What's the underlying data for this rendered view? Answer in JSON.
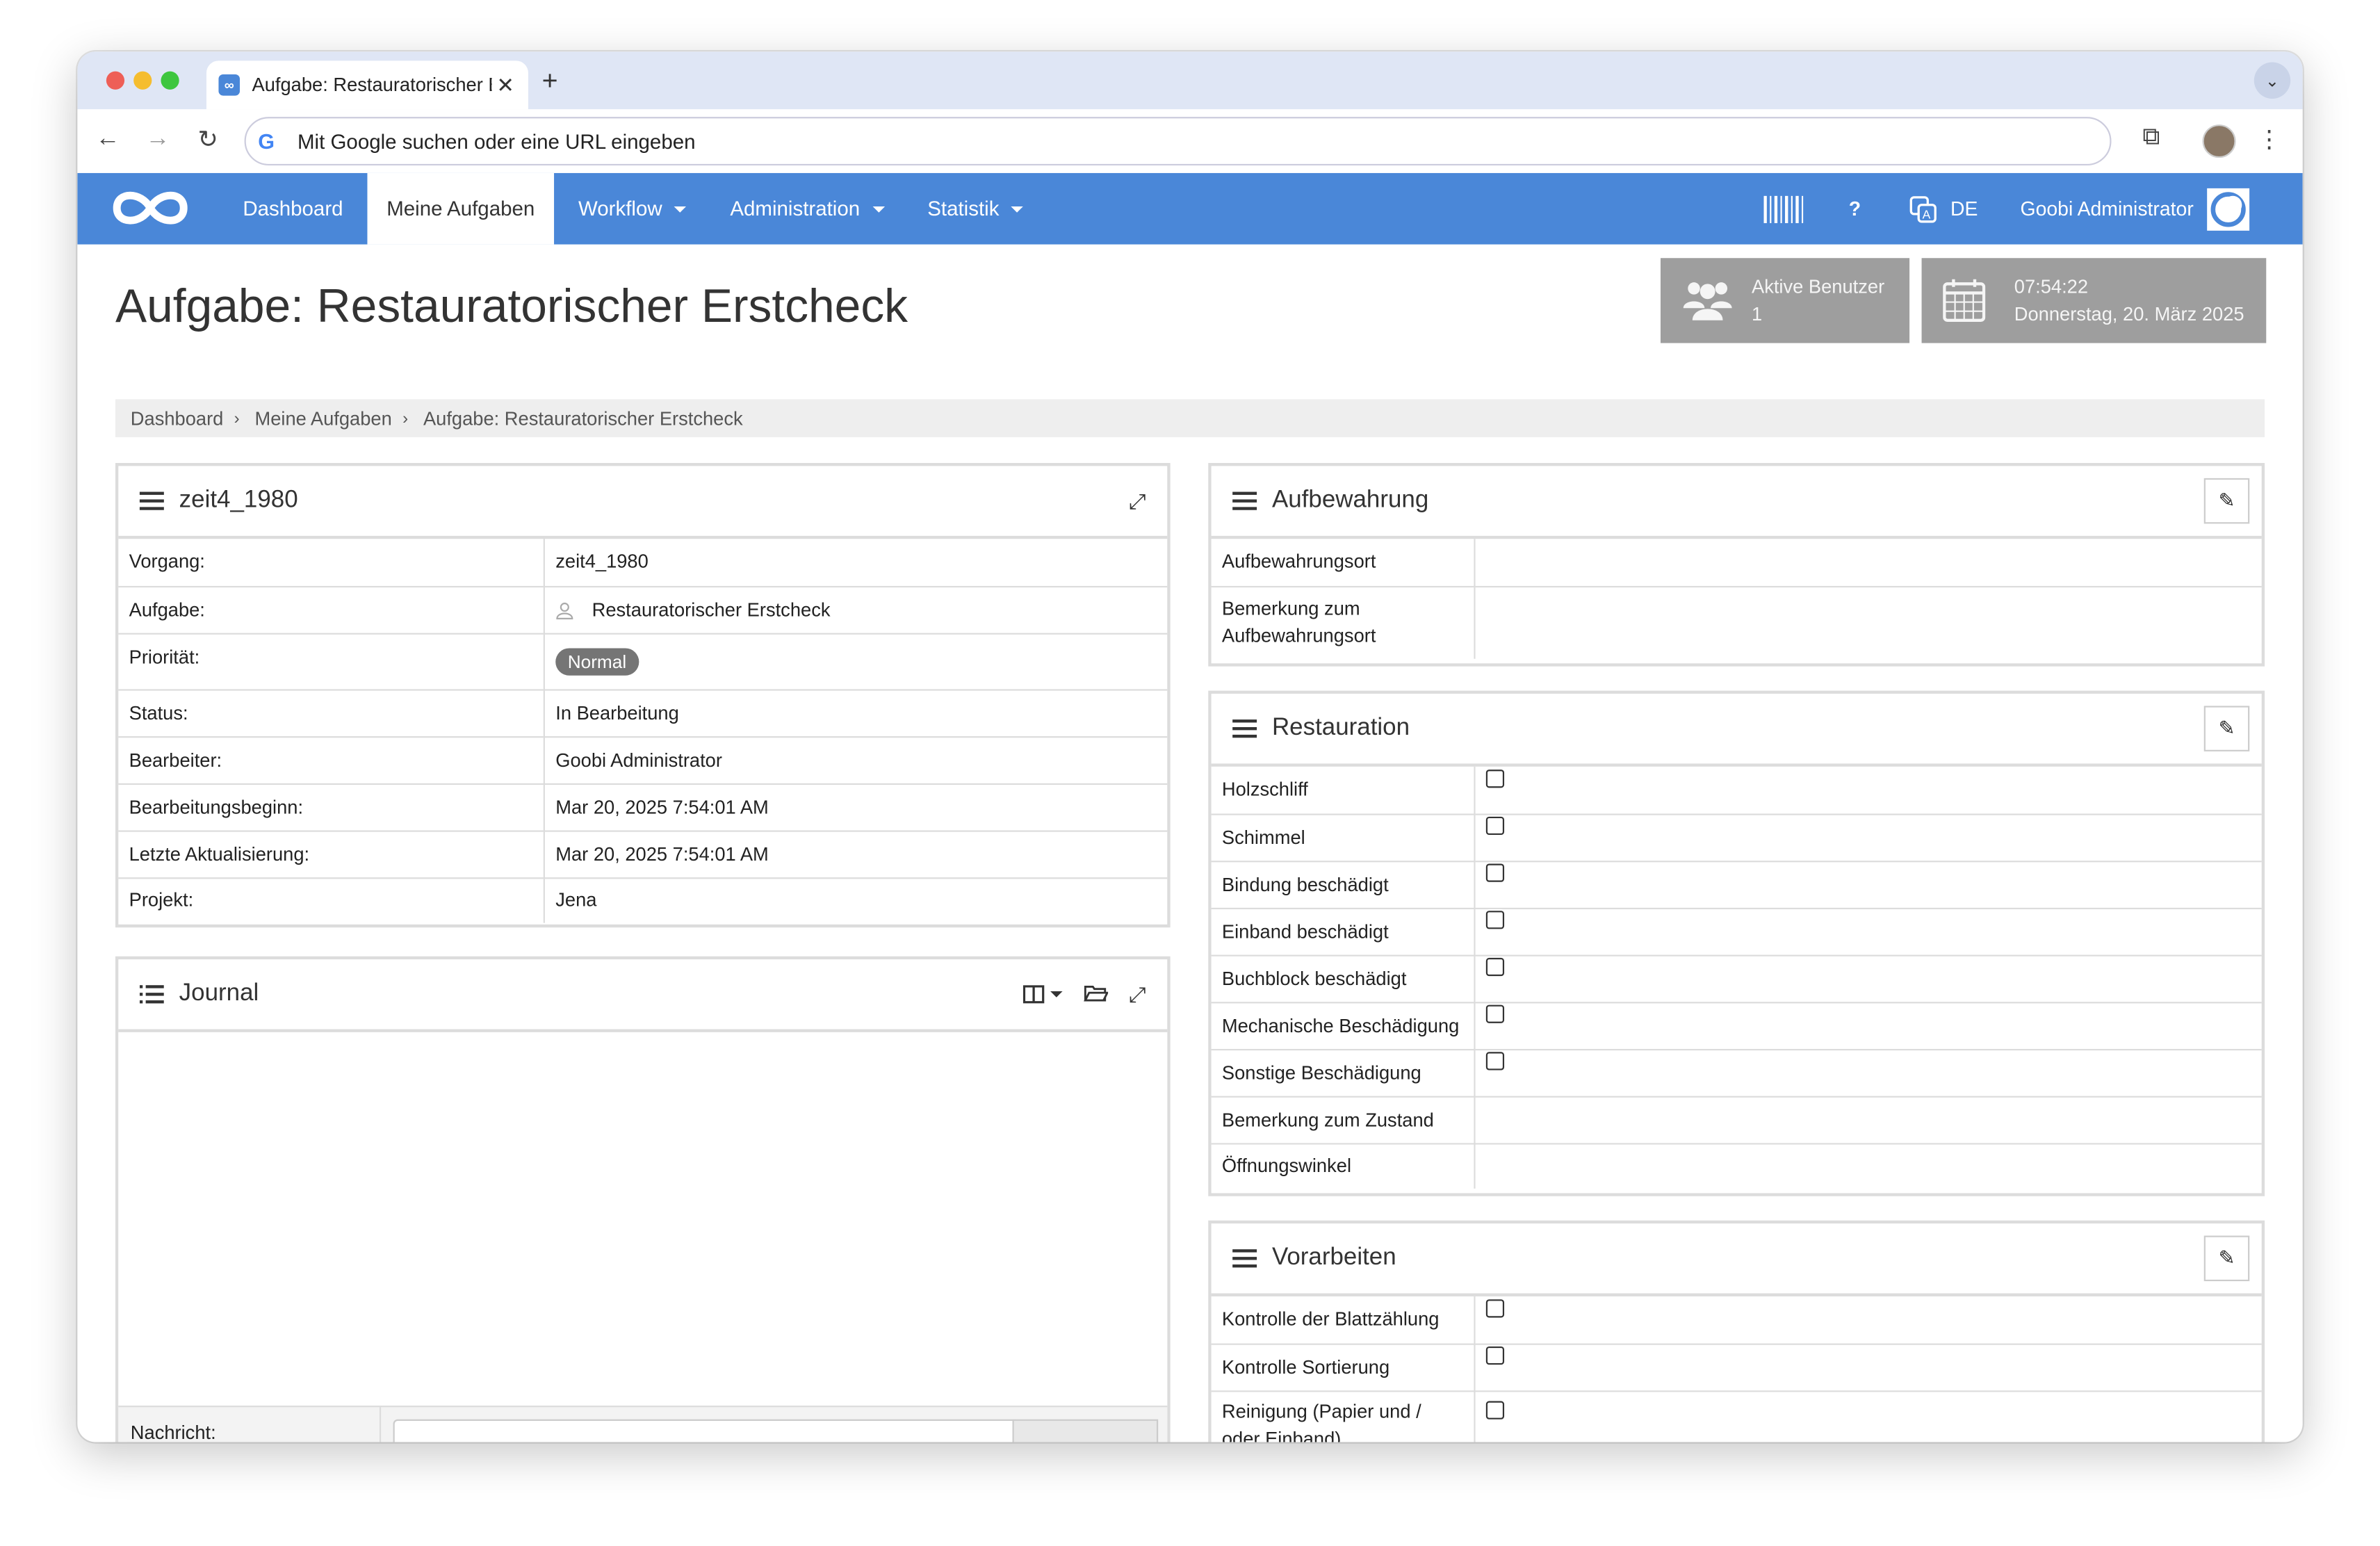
{
  "browser": {
    "tab_title": "Aufgabe: Restauratorischer Erstcheck",
    "address_placeholder": "Mit Google suchen oder eine URL eingeben"
  },
  "navbar": {
    "items": [
      {
        "label": "Dashboard"
      },
      {
        "label": "Meine Aufgaben"
      },
      {
        "label": "Workflow"
      },
      {
        "label": "Administration"
      },
      {
        "label": "Statistik"
      }
    ],
    "help": "?",
    "language": "DE",
    "user": "Goobi Administrator"
  },
  "page": {
    "title": "Aufgabe: Restauratorischer Erstcheck",
    "active_users_label": "Aktive Benutzer",
    "active_users_count": "1",
    "time": "07:54:22",
    "date": "Donnerstag, 20. März 2025"
  },
  "breadcrumb": [
    "Dashboard",
    "Meine Aufgaben",
    "Aufgabe: Restauratorischer Erstcheck"
  ],
  "details": {
    "title": "zeit4_1980",
    "rows": [
      {
        "key": "Vorgang:",
        "value": "zeit4_1980"
      },
      {
        "key": "Aufgabe:",
        "value": "Restauratorischer Erstcheck"
      },
      {
        "key": "Priorität:",
        "value": "Normal"
      },
      {
        "key": "Status:",
        "value": "In Bearbeitung"
      },
      {
        "key": "Bearbeiter:",
        "value": "Goobi Administrator"
      },
      {
        "key": "Bearbeitungsbeginn:",
        "value": "Mar 20, 2025 7:54:01 AM"
      },
      {
        "key": "Letzte Aktualisierung:",
        "value": "Mar 20, 2025 7:54:01 AM"
      },
      {
        "key": "Projekt:",
        "value": "Jena"
      }
    ]
  },
  "journal": {
    "title": "Journal",
    "message_label": "Nachricht:"
  },
  "aufbewahrung": {
    "title": "Aufbewahrung",
    "rows": [
      {
        "key": "Aufbewahrungsort"
      },
      {
        "key": "Bemerkung zum Aufbewahrungsort"
      }
    ]
  },
  "restauration": {
    "title": "Restauration",
    "rows": [
      {
        "key": "Holzschliff",
        "checkbox": true,
        "checked": false
      },
      {
        "key": "Schimmel",
        "checkbox": true,
        "checked": false
      },
      {
        "key": "Bindung beschädigt",
        "checkbox": true,
        "checked": false
      },
      {
        "key": "Einband beschädigt",
        "checkbox": true,
        "checked": false
      },
      {
        "key": "Buchblock beschädigt",
        "checkbox": true,
        "checked": false
      },
      {
        "key": "Mechanische Beschädigung",
        "checkbox": true,
        "checked": false
      },
      {
        "key": "Sonstige Beschädigung",
        "checkbox": true,
        "checked": false
      },
      {
        "key": "Bemerkung zum Zustand",
        "checkbox": false
      },
      {
        "key": "Öffnungswinkel",
        "checkbox": false
      }
    ]
  },
  "vorarbeiten": {
    "title": "Vorarbeiten",
    "rows": [
      {
        "key": "Kontrolle der Blattzählung",
        "checkbox": true,
        "checked": false
      },
      {
        "key": "Kontrolle Sortierung",
        "checkbox": true,
        "checked": false
      },
      {
        "key": "Reinigung (Papier und / oder Einband)",
        "checkbox": true,
        "checked": false
      }
    ]
  },
  "colors": {
    "navbar": "#4a87d8",
    "infobox": "#9e9e9e",
    "badge": "#757575"
  }
}
